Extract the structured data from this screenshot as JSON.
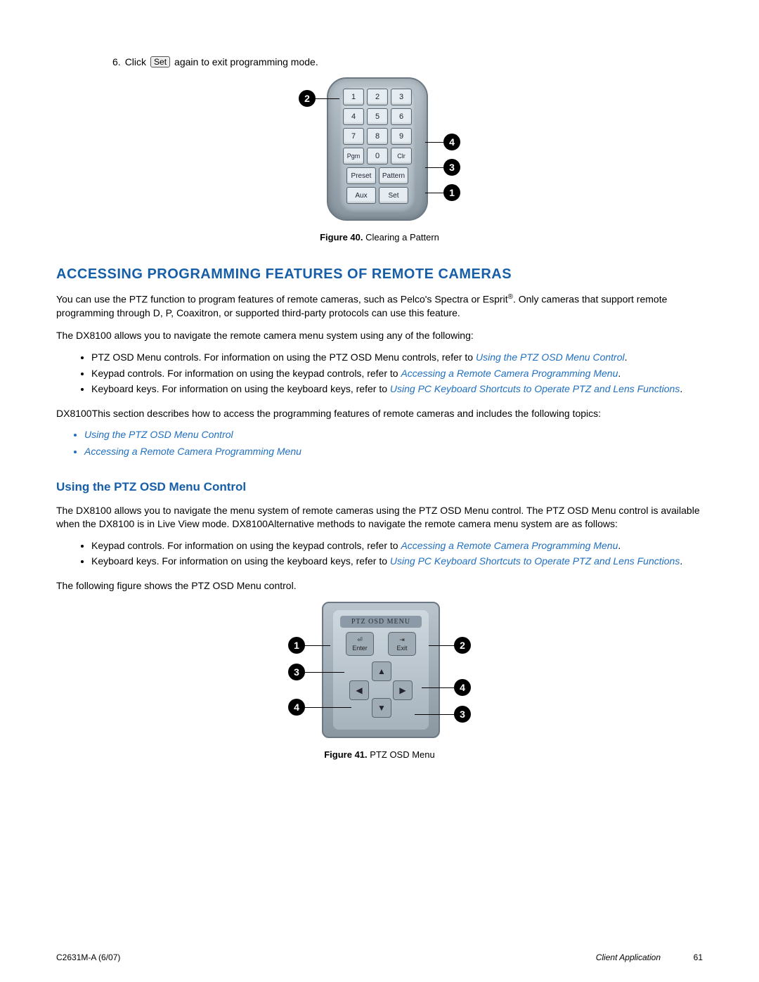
{
  "step": {
    "num": "6.",
    "pre": "Click",
    "btn": "Set",
    "post": "again to exit programming mode."
  },
  "fig40": {
    "caption_bold": "Figure 40.",
    "caption": "Clearing a Pattern",
    "keys": {
      "r1": [
        "1",
        "2",
        "3"
      ],
      "r2": [
        "4",
        "5",
        "6"
      ],
      "r3": [
        "7",
        "8",
        "9"
      ],
      "r4": [
        "Pgm",
        "0",
        "Clr"
      ],
      "r5": [
        "Preset",
        "Pattern"
      ],
      "r6": [
        "Aux",
        "Set"
      ]
    },
    "callouts": [
      "1",
      "2",
      "3",
      "4"
    ]
  },
  "s1": {
    "title": "ACCESSING PROGRAMMING FEATURES OF REMOTE CAMERAS",
    "p1a": "You can use the PTZ function to program features of remote cameras, such as Pelco's Spectra or Esprit",
    "p1b": ". Only cameras that support remote programming through D, P, Coaxitron, or supported third-party protocols can use this feature.",
    "p2": "The DX8100 allows you to navigate the remote camera menu system using any of the following:",
    "b1_pre": "PTZ OSD Menu controls. For information on using the PTZ OSD Menu controls, refer to ",
    "b1_link": "Using the PTZ OSD Menu Control",
    "b2_pre": "Keypad controls. For information on using the keypad controls, refer to ",
    "b2_link": "Accessing a Remote Camera Programming Menu",
    "b3_pre": "Keyboard keys. For information on using the keyboard keys, refer to ",
    "b3_link": "Using PC Keyboard Shortcuts to Operate PTZ and Lens Functions",
    "p3": "DX8100This section describes how to access the programming features of remote cameras and includes the following topics:",
    "toc1": "Using the PTZ OSD Menu Control",
    "toc2": "Accessing a Remote Camera Programming Menu"
  },
  "s2": {
    "title": "Using the PTZ OSD Menu Control",
    "p1": "The DX8100 allows you to navigate the menu system of remote cameras using the PTZ OSD Menu control. The PTZ OSD Menu control is available when the DX8100 is in Live View mode. DX8100Alternative methods to navigate the remote camera menu system are as follows:",
    "b1_pre": "Keypad controls. For information on using the keypad controls, refer to ",
    "b1_link": "Accessing a Remote Camera Programming Menu",
    "b2_pre": "Keyboard keys. For information on using the keyboard keys, refer to ",
    "b2_link": "Using PC Keyboard Shortcuts to Operate PTZ and Lens Functions",
    "p2": "The following figure shows the PTZ OSD Menu control."
  },
  "fig41": {
    "caption_bold": "Figure 41.",
    "caption": "PTZ OSD Menu",
    "title": "PTZ OSD MENU",
    "enter": "Enter",
    "exit": "Exit",
    "callouts": [
      "1",
      "2",
      "3",
      "4"
    ]
  },
  "footer": {
    "left": "C2631M-A (6/07)",
    "mid": "Client Application",
    "pg": "61"
  }
}
